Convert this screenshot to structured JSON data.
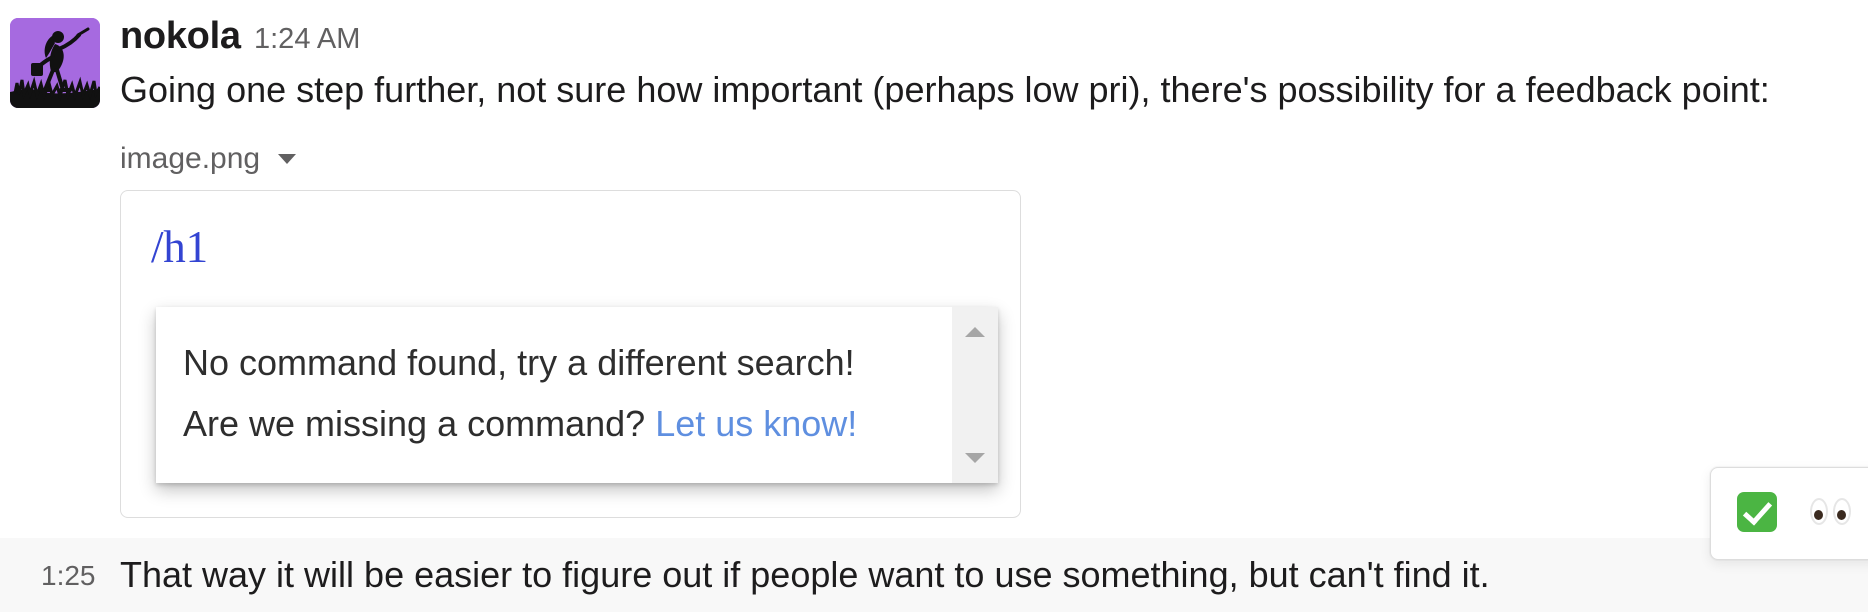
{
  "message": {
    "author": "nokola",
    "timestamp": "1:24 AM",
    "text": "Going one step further, not sure how important (perhaps low pri), there's possibility for a feedback point:",
    "attachment": {
      "filename": "image.png",
      "expand_icon": "chevron-down-icon",
      "preview": {
        "command_text": "/h1",
        "popup": {
          "line1": "No command found, try a different search!",
          "line2_prefix": "Are we missing a command? ",
          "line2_link": "Let us know!"
        },
        "scrollbar_icons": [
          "chevron-up-icon",
          "chevron-down-icon"
        ]
      }
    },
    "avatar_icon": "user-avatar-icon"
  },
  "followup": {
    "time": "1:25",
    "text": "That way it will be easier to figure out if people want to use something, but can't find it."
  },
  "reactions": [
    {
      "name": "white-check-mark",
      "icon": "check-mark-icon"
    },
    {
      "name": "eyes",
      "icon": "eyes-icon"
    }
  ],
  "colors": {
    "author": "#1d1c1d",
    "muted_text": "#616061",
    "command_blue": "#3344d2",
    "link_blue": "#5f8fe0",
    "hover_background": "#f8f8f8",
    "check_green": "#4bb543",
    "avatar_purple": "#9a58d5"
  }
}
